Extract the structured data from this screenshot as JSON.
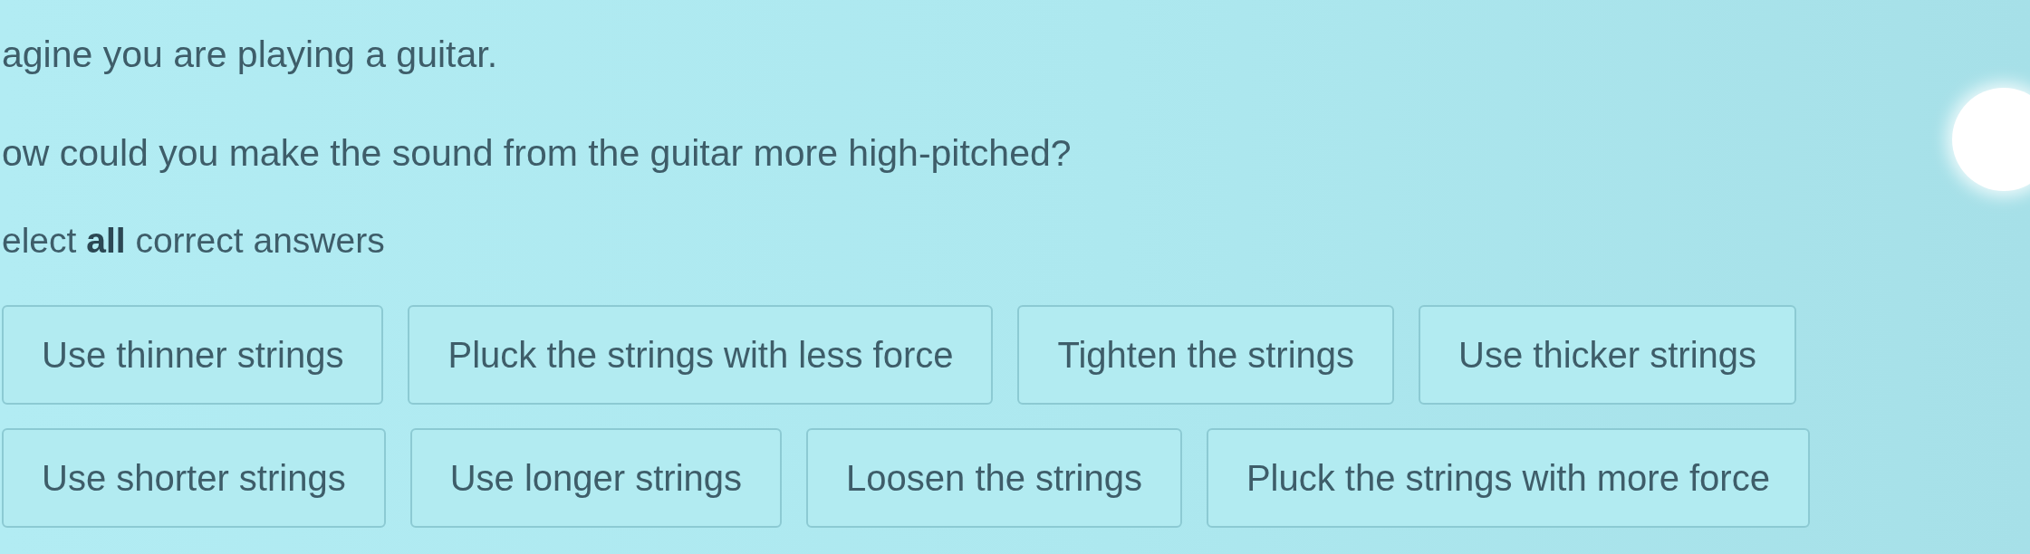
{
  "prompt": {
    "intro": "agine you are playing a guitar.",
    "question": "ow could you make the sound from the guitar more high-pitched?",
    "instruction": "elect **all** correct answers"
  },
  "answer_rows": [
    [
      {
        "label": "Use thinner strings",
        "selected": false
      },
      {
        "label": "Pluck the strings with less force",
        "selected": false
      },
      {
        "label": "Tighten the strings",
        "selected": false
      },
      {
        "label": "Use thicker strings",
        "selected": false
      }
    ],
    [
      {
        "label": "Use shorter strings",
        "selected": false
      },
      {
        "label": "Use longer strings",
        "selected": false
      },
      {
        "label": "Loosen the strings",
        "selected": false
      },
      {
        "label": "Pluck the strings with more force",
        "selected": false
      }
    ]
  ]
}
